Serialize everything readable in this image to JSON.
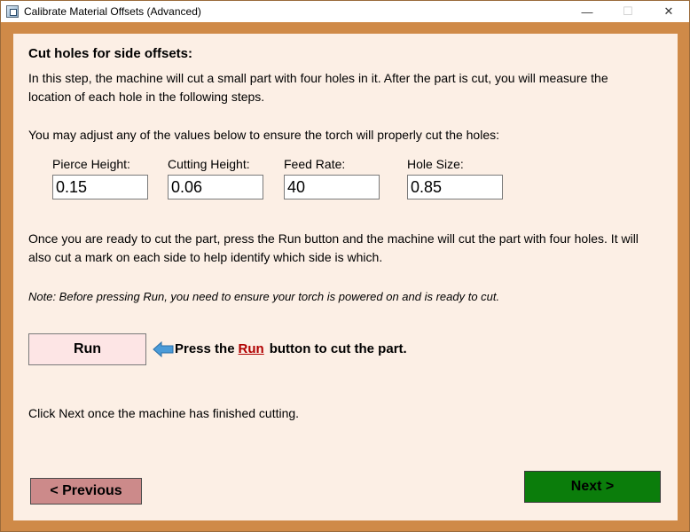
{
  "window": {
    "title": "Calibrate Material Offsets (Advanced)",
    "minimize_glyph": "—",
    "maximize_glyph": "☐",
    "close_glyph": "✕"
  },
  "main": {
    "heading": "Cut holes for side offsets:",
    "intro": "In this step, the machine will cut a small part with four holes in it. After the part is cut, you will measure the location of each hole in the following steps.",
    "adjust_text": "You may adjust any of the values below to ensure the torch will properly cut the holes:",
    "fields": [
      {
        "label": "Pierce Height:",
        "value": "0.15"
      },
      {
        "label": "Cutting Height:",
        "value": "0.06"
      },
      {
        "label": "Feed Rate:",
        "value": "40"
      },
      {
        "label": "Hole Size:",
        "value": "0.85"
      }
    ],
    "ready_text": "Once you are ready to cut the part, press the Run button and the machine will cut the part with four holes. It will also cut a mark on each side to help identify which side is which.",
    "note": "Note: Before pressing Run, you need to ensure your torch is powered on and is ready to cut.",
    "run_button": "Run",
    "press_prefix": "Press the",
    "press_link": "Run",
    "press_suffix": "button to cut the part.",
    "finish_text": "Click Next once the machine has finished cutting."
  },
  "footer": {
    "previous_button": "< Previous",
    "next_button": "Next >"
  },
  "icons": {
    "arrow": "arrow-left-icon",
    "app": "app-icon"
  },
  "colors": {
    "frame": "#cf8a48",
    "panel": "#fcefe5",
    "run_button": "#fde5e5",
    "previous_button": "#cc8a8a",
    "next_button": "#0b7d0b",
    "link": "#b00000",
    "arrow": "#4a9bd8"
  }
}
